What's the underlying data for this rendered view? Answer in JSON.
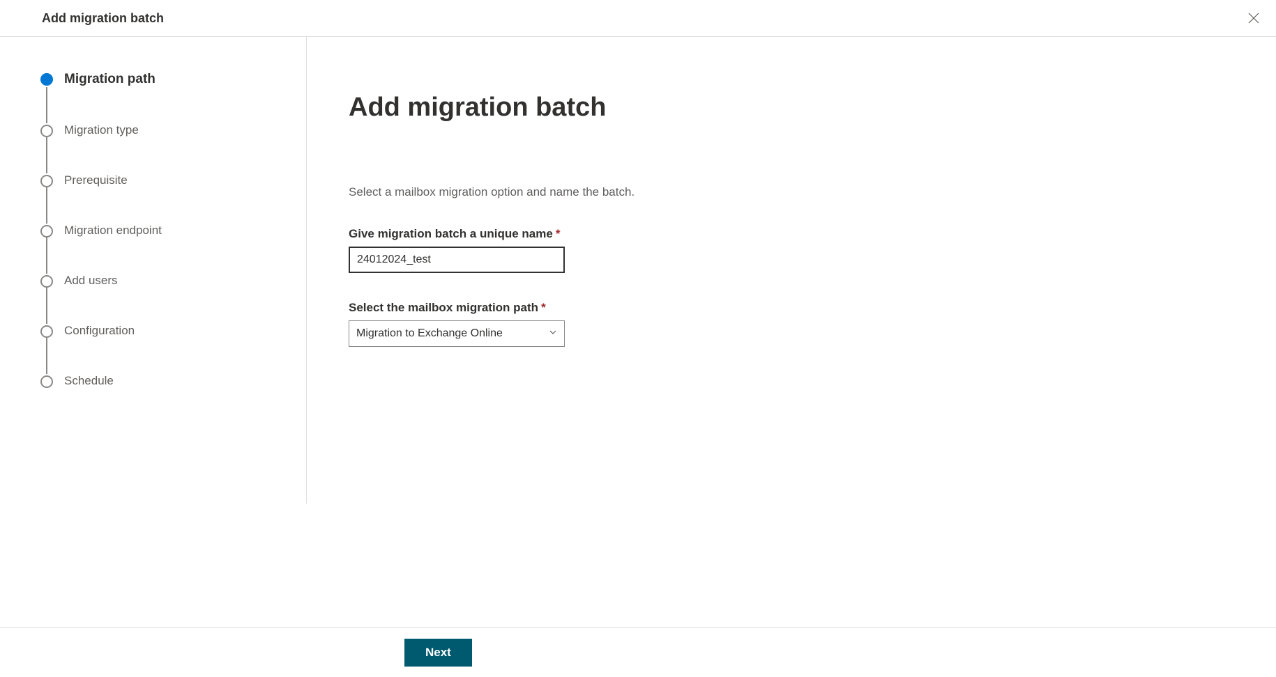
{
  "header": {
    "title": "Add migration batch"
  },
  "sidebar": {
    "steps": [
      {
        "label": "Migration path",
        "active": true
      },
      {
        "label": "Migration type",
        "active": false
      },
      {
        "label": "Prerequisite",
        "active": false
      },
      {
        "label": "Migration endpoint",
        "active": false
      },
      {
        "label": "Add users",
        "active": false
      },
      {
        "label": "Configuration",
        "active": false
      },
      {
        "label": "Schedule",
        "active": false
      }
    ]
  },
  "main": {
    "title": "Add migration batch",
    "description": "Select a mailbox migration option and name the batch.",
    "name_label": "Give migration batch a unique name",
    "name_value": "24012024_test",
    "path_label": "Select the mailbox migration path",
    "path_value": "Migration to Exchange Online"
  },
  "footer": {
    "next_label": "Next"
  }
}
